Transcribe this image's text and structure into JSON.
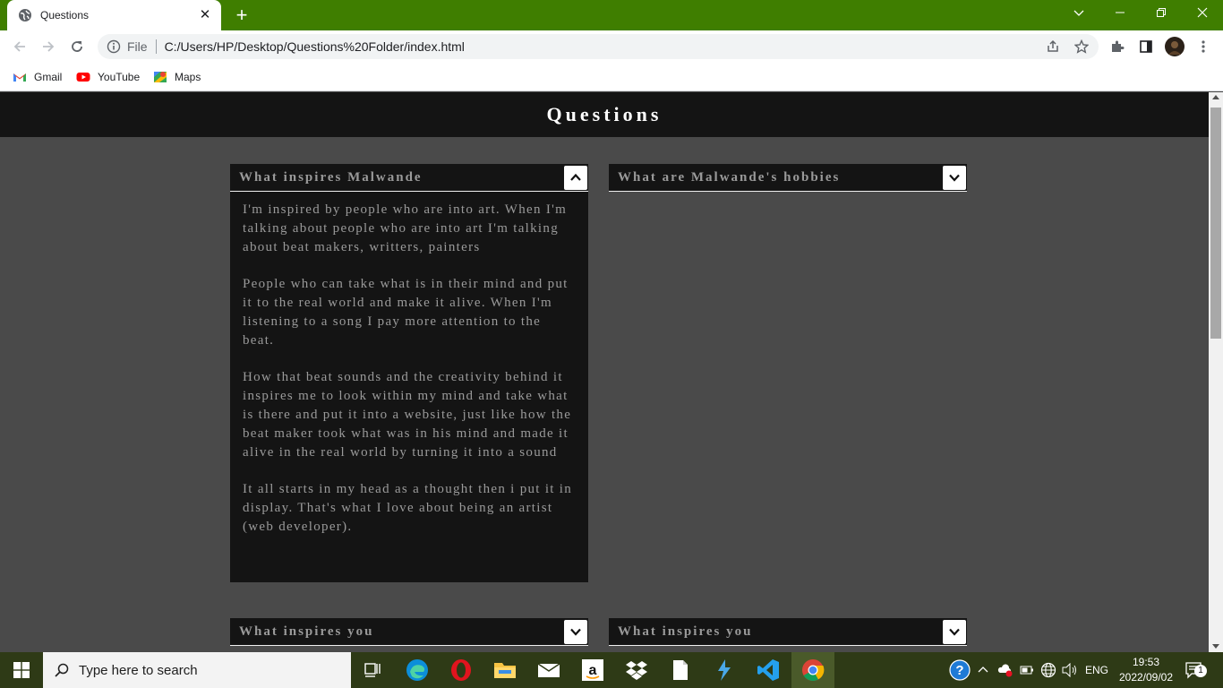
{
  "browser": {
    "tab_title": "Questions",
    "tab_close": "✕",
    "new_tab": "+",
    "scheme_label": "File",
    "url": "C:/Users/HP/Desktop/Questions%20Folder/index.html",
    "bookmarks": [
      "Gmail",
      "YouTube",
      "Maps"
    ],
    "window_controls": {
      "minimize": "—",
      "restore": "❐",
      "close": "✕",
      "tab_search": "⌄"
    }
  },
  "page": {
    "title": "Questions",
    "questions": [
      {
        "label": "What inspires Malwande",
        "expanded": true,
        "paragraphs": [
          "I'm inspired by people who are into art. When I'm talking about people who are into art I'm talking about beat makers, writters, painters",
          "People who can take what is in their mind and put it to the real world and make it alive. When I'm listening to a song I pay more attention to the beat.",
          "How that beat sounds and the creativity behind it inspires me to look within my mind and take what is there and put it into a website, just like how the beat maker took what was in his mind and made it alive in the real world by turning it into a sound",
          "It all starts in my head as a thought then i put it in display. That's what I love about being an artist (web developer)."
        ]
      },
      {
        "label": "What are Malwande's hobbies",
        "expanded": false
      },
      {
        "label": "What inspires you",
        "expanded": false
      },
      {
        "label": "What inspires you",
        "expanded": false
      }
    ]
  },
  "taskbar": {
    "search_placeholder": "Type here to search",
    "language": "ENG",
    "time": "19:53",
    "date": "2022/09/02",
    "notification_count": "1"
  },
  "colors": {
    "chrome_frame": "#3f7e00",
    "page_bg": "#4a4a4a",
    "header_bg": "#141414",
    "question_text": "#9a9a9a",
    "taskbar": "#2e3a16"
  }
}
